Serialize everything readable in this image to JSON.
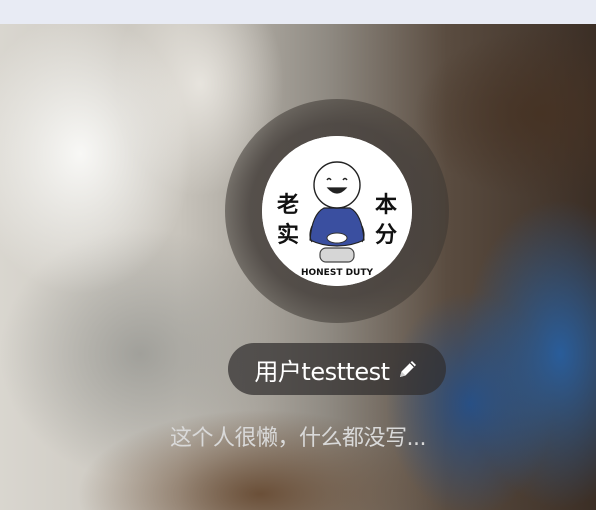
{
  "profile": {
    "avatar": {
      "left_text": "老实",
      "right_text": "本分",
      "caption": "HONEST DUTY",
      "shirt_color": "#3a4fa0"
    },
    "username": "用户testtest",
    "edit_icon": "pencil-icon",
    "bio": "这个人很懒，什么都没写..."
  }
}
